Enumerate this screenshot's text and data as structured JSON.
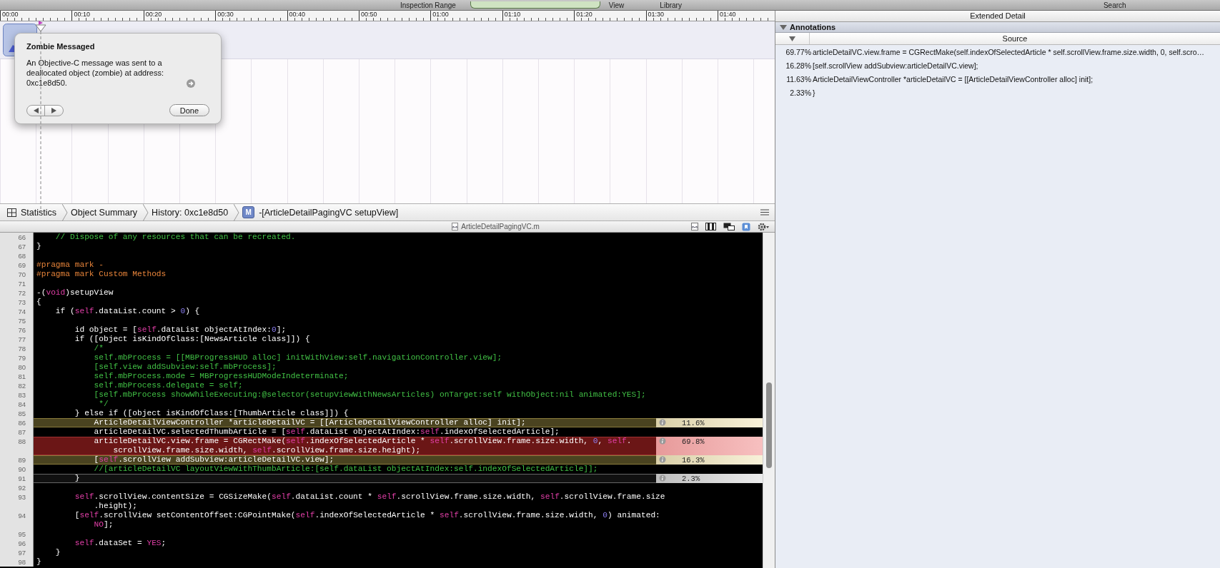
{
  "toolbar": {
    "labels": [
      "Inspection Range",
      "View",
      "Library",
      "Search"
    ]
  },
  "timeline": {
    "ticks": [
      "00:00",
      "00:10",
      "00:20",
      "00:30",
      "00:40",
      "00:50",
      "01:00",
      "01:10",
      "01:20",
      "01:30",
      "01:40"
    ]
  },
  "zombie_popup": {
    "title": "Zombie Messaged",
    "message": "An Objective-C message was sent to a deallocated object (zombie) at address: 0xc1e8d50.",
    "button": "Done"
  },
  "breadcrumbs": [
    {
      "label": "Statistics",
      "kind": "statistics"
    },
    {
      "label": "Object Summary",
      "kind": "plain"
    },
    {
      "label": "History: 0xc1e8d50",
      "kind": "plain"
    },
    {
      "label": "-[ArticleDetailPagingVC setupView]",
      "kind": "method",
      "badge": "M"
    }
  ],
  "editor": {
    "filename": "ArticleDetailPagingVC.m",
    "lines": [
      {
        "number": "66",
        "tokens": [
          {
            "kind": "comment",
            "text": "    // Dispose of any resources that can be recreated."
          }
        ]
      },
      {
        "number": "67",
        "tokens": [
          {
            "kind": "plain",
            "text": "}"
          }
        ]
      },
      {
        "number": "68"
      },
      {
        "number": "69",
        "tokens": [
          {
            "kind": "pragma",
            "text": "#pragma mark -"
          }
        ]
      },
      {
        "number": "70",
        "tokens": [
          {
            "kind": "pragma",
            "text": "#pragma mark Custom Methods"
          }
        ]
      },
      {
        "number": "71"
      },
      {
        "number": "72",
        "tokens": [
          {
            "kind": "plain",
            "text": "-("
          },
          {
            "kind": "keyword",
            "text": "void"
          },
          {
            "kind": "plain",
            "text": ")setupView"
          }
        ]
      },
      {
        "number": "73",
        "tokens": [
          {
            "kind": "plain",
            "text": "{"
          }
        ]
      },
      {
        "number": "74",
        "tokens": [
          {
            "kind": "plain",
            "text": "    if ("
          },
          {
            "kind": "keyword",
            "text": "self"
          },
          {
            "kind": "plain",
            "text": ".dataList.count > "
          },
          {
            "kind": "number",
            "text": "0"
          },
          {
            "kind": "plain",
            "text": ") {"
          }
        ]
      },
      {
        "number": "75"
      },
      {
        "number": "76",
        "tokens": [
          {
            "kind": "plain",
            "text": "        id object = ["
          },
          {
            "kind": "keyword",
            "text": "self"
          },
          {
            "kind": "plain",
            "text": ".dataList objectAtIndex:"
          },
          {
            "kind": "number",
            "text": "0"
          },
          {
            "kind": "plain",
            "text": "];"
          }
        ]
      },
      {
        "number": "77",
        "tokens": [
          {
            "kind": "plain",
            "text": "        if ([object isKindOfClass:[NewsArticle class]]) {"
          }
        ]
      },
      {
        "number": "78",
        "tokens": [
          {
            "kind": "comment",
            "text": "            /*"
          }
        ]
      },
      {
        "number": "79",
        "tokens": [
          {
            "kind": "comment",
            "text": "            self.mbProcess = [[MBProgressHUD alloc] initWithView:self.navigationController.view];"
          }
        ]
      },
      {
        "number": "80",
        "tokens": [
          {
            "kind": "comment",
            "text": "            [self.view addSubview:self.mbProcess];"
          }
        ]
      },
      {
        "number": "81",
        "tokens": [
          {
            "kind": "comment",
            "text": "            self.mbProcess.mode = MBProgressHUDModeIndeterminate;"
          }
        ]
      },
      {
        "number": "82",
        "tokens": [
          {
            "kind": "comment",
            "text": "            self.mbProcess.delegate = self;"
          }
        ]
      },
      {
        "number": "83",
        "tokens": [
          {
            "kind": "comment",
            "text": "            [self.mbProcess showWhileExecuting:@selector(setupViewWithNewsArticles) onTarget:self withObject:nil animated:YES];"
          }
        ]
      },
      {
        "number": "84",
        "tokens": [
          {
            "kind": "comment",
            "text": "             */"
          }
        ]
      },
      {
        "number": "85",
        "tokens": [
          {
            "kind": "plain",
            "text": "        } else if ([object isKindOfClass:[ThumbArticle class]]) {"
          }
        ]
      },
      {
        "number": "86",
        "kind": "warm",
        "percent": "11.6%",
        "tokens": [
          {
            "kind": "plain",
            "text": "            ArticleDetailViewController *articleDetailVC = [[ArticleDetailViewController alloc] init];"
          }
        ]
      },
      {
        "number": "87",
        "tokens": [
          {
            "kind": "plain",
            "text": "            articleDetailVC.selectedThumbArticle = ["
          },
          {
            "kind": "keyword",
            "text": "self"
          },
          {
            "kind": "plain",
            "text": ".dataList objectAtIndex:"
          },
          {
            "kind": "keyword",
            "text": "self"
          },
          {
            "kind": "plain",
            "text": ".indexOfSelectedArticle];"
          }
        ]
      },
      {
        "number": "88",
        "kind": "hot",
        "percent": "69.8%",
        "tokens": [
          {
            "kind": "plain",
            "text": "            articleDetailVC.view.frame = CGRectMake("
          },
          {
            "kind": "keyword",
            "text": "self"
          },
          {
            "kind": "plain",
            "text": ".indexOfSelectedArticle * "
          },
          {
            "kind": "keyword",
            "text": "self"
          },
          {
            "kind": "plain",
            "text": ".scrollView.frame.size.width, "
          },
          {
            "kind": "number",
            "text": "0"
          },
          {
            "kind": "plain",
            "text": ", "
          },
          {
            "kind": "keyword",
            "text": "self"
          },
          {
            "kind": "plain",
            "text": "."
          }
        ],
        "continuation": [
          {
            "kind": "plain",
            "text": "                scrollView.frame.size.width, "
          },
          {
            "kind": "keyword",
            "text": "self"
          },
          {
            "kind": "plain",
            "text": ".scrollView.frame.size.height);"
          }
        ]
      },
      {
        "number": "89",
        "kind": "warm",
        "percent": "16.3%",
        "tokens": [
          {
            "kind": "plain",
            "text": "            ["
          },
          {
            "kind": "keyword",
            "text": "self"
          },
          {
            "kind": "plain",
            "text": ".scrollView addSubview:articleDetailVC.view];"
          }
        ]
      },
      {
        "number": "90",
        "tokens": [
          {
            "kind": "comment",
            "text": "            //[articleDetailVC layoutViewWithThumbArticle:[self.dataList objectAtIndex:self.indexOfSelectedArticle]];"
          }
        ]
      },
      {
        "number": "91",
        "kind": "cool",
        "percent": "2.3%",
        "tokens": [
          {
            "kind": "plain",
            "text": "        }"
          }
        ]
      },
      {
        "number": "92"
      },
      {
        "number": "93",
        "tokens": [
          {
            "kind": "keyword",
            "text": "        self"
          },
          {
            "kind": "plain",
            "text": ".scrollView.contentSize = CGSizeMake("
          },
          {
            "kind": "keyword",
            "text": "self"
          },
          {
            "kind": "plain",
            "text": ".dataList.count * "
          },
          {
            "kind": "keyword",
            "text": "self"
          },
          {
            "kind": "plain",
            "text": ".scrollView.frame.size.width, "
          },
          {
            "kind": "keyword",
            "text": "self"
          },
          {
            "kind": "plain",
            "text": ".scrollView.frame.size"
          }
        ],
        "continuation": [
          {
            "kind": "plain",
            "text": "            .height);"
          }
        ]
      },
      {
        "number": "94",
        "tokens": [
          {
            "kind": "plain",
            "text": "        ["
          },
          {
            "kind": "keyword",
            "text": "self"
          },
          {
            "kind": "plain",
            "text": ".scrollView setContentOffset:CGPointMake("
          },
          {
            "kind": "keyword",
            "text": "self"
          },
          {
            "kind": "plain",
            "text": ".indexOfSelectedArticle * "
          },
          {
            "kind": "keyword",
            "text": "self"
          },
          {
            "kind": "plain",
            "text": ".scrollView.frame.size.width, "
          },
          {
            "kind": "number",
            "text": "0"
          },
          {
            "kind": "plain",
            "text": ") animated:"
          }
        ],
        "continuation": [
          {
            "kind": "keyword",
            "text": "            NO"
          },
          {
            "kind": "plain",
            "text": "];"
          }
        ]
      },
      {
        "number": "95"
      },
      {
        "number": "96",
        "tokens": [
          {
            "kind": "keyword",
            "text": "        self"
          },
          {
            "kind": "plain",
            "text": ".dataSet = "
          },
          {
            "kind": "keyword",
            "text": "YES"
          },
          {
            "kind": "plain",
            "text": ";"
          }
        ]
      },
      {
        "number": "97",
        "tokens": [
          {
            "kind": "plain",
            "text": "    }"
          }
        ]
      },
      {
        "number": "98",
        "tokens": [
          {
            "kind": "plain",
            "text": "}"
          }
        ]
      }
    ]
  },
  "extended_detail": {
    "title": "Extended Detail",
    "section": "Annotations",
    "expanded": true,
    "column": "Source",
    "rows": [
      {
        "percent": "69.77%",
        "source": "articleDetailVC.view.frame = CGRectMake(self.indexOfSelectedArticle * self.scrollView.frame.size.width, 0, self.scro…"
      },
      {
        "percent": "16.28%",
        "source": "[self.scrollView addSubview:articleDetailVC.view];"
      },
      {
        "percent": "11.63%",
        "source": "ArticleDetailViewController *articleDetailVC = [[ArticleDetailViewController alloc] init];"
      },
      {
        "percent": "2.33%",
        "source": "}"
      }
    ]
  }
}
